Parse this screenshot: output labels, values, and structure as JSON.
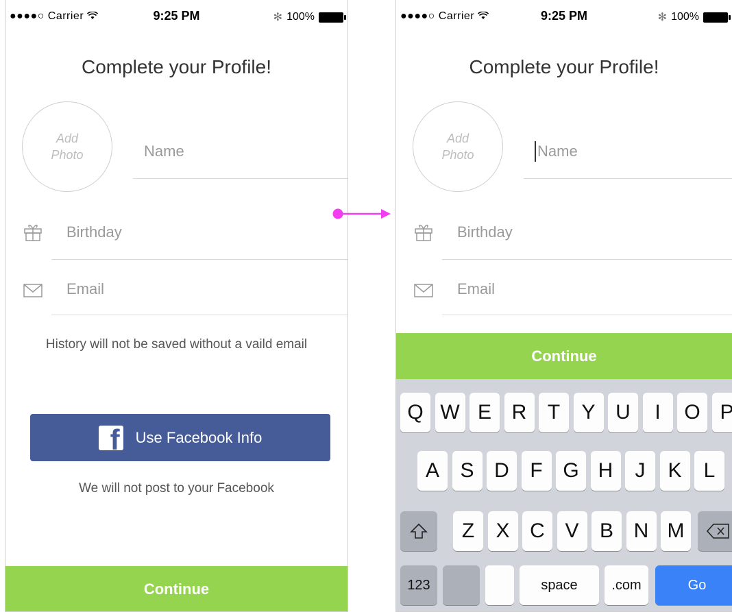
{
  "status_bar": {
    "carrier": "●●●●○ Carrier",
    "wifi_icon": "wifi-icon",
    "time": "9:25 PM",
    "bluetooth_icon": "bluetooth-icon",
    "battery": "100%"
  },
  "profile": {
    "title": "Complete your Profile!",
    "photo_label": "Add Photo",
    "name_placeholder": "Name",
    "birthday_placeholder": "Birthday",
    "email_placeholder": "Email",
    "email_note": "History will not be saved without a vaild email",
    "facebook_button": "Use Facebook Info",
    "facebook_note": "We will not post to your Facebook",
    "continue_label": "Continue"
  },
  "keyboard": {
    "row1": [
      "Q",
      "W",
      "E",
      "R",
      "T",
      "Y",
      "U",
      "I",
      "O",
      "P"
    ],
    "row2": [
      "A",
      "S",
      "D",
      "F",
      "G",
      "H",
      "J",
      "K",
      "L"
    ],
    "row3": [
      "Z",
      "X",
      "C",
      "V",
      "B",
      "N",
      "M"
    ],
    "numbers_key": "123",
    "space_key": "space",
    "dotcom_key": ".com",
    "go_key": "Go"
  },
  "colors": {
    "accent_green": "#95d44f",
    "facebook_blue": "#455c99",
    "go_blue": "#3a82f7",
    "arrow_magenta": "#f23df0"
  }
}
